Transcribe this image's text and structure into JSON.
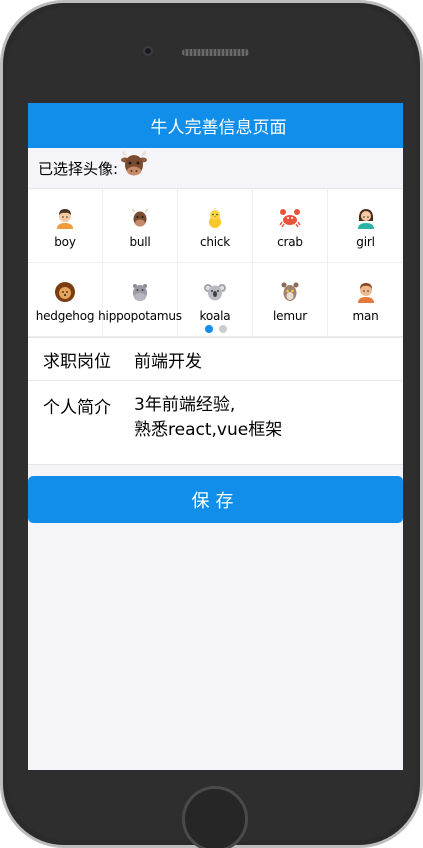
{
  "navbar": {
    "title": "牛人完善信息页面"
  },
  "avatar_picker": {
    "header_label": "已选择头像:",
    "selected": "bull",
    "items": [
      {
        "label": "boy",
        "icon": "boy-icon"
      },
      {
        "label": "bull",
        "icon": "bull-icon"
      },
      {
        "label": "chick",
        "icon": "chick-icon"
      },
      {
        "label": "crab",
        "icon": "crab-icon"
      },
      {
        "label": "girl",
        "icon": "girl-icon"
      },
      {
        "label": "hedgehog",
        "icon": "hedgehog-icon"
      },
      {
        "label": "hippopotamus",
        "icon": "hippopotamus-icon"
      },
      {
        "label": "koala",
        "icon": "koala-icon"
      },
      {
        "label": "lemur",
        "icon": "lemur-icon"
      },
      {
        "label": "man",
        "icon": "man-icon"
      }
    ],
    "pages": 2,
    "active_page": 1
  },
  "form": {
    "position": {
      "label": "求职岗位",
      "value": "前端开发"
    },
    "intro": {
      "label": "个人简介",
      "line1": "3年前端经验,",
      "line2": "熟悉react,vue框架"
    }
  },
  "save_button": {
    "label": "保存"
  },
  "colors": {
    "primary": "#108ee9",
    "background": "#f5f5f9"
  }
}
